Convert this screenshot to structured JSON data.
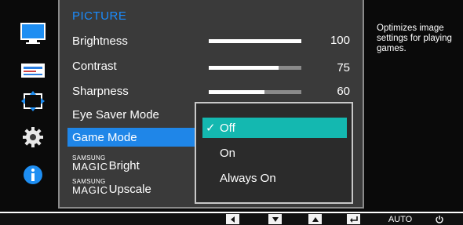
{
  "menu": {
    "title": "PICTURE",
    "items": [
      {
        "label": "Brightness",
        "value": "100",
        "level": 1.0
      },
      {
        "label": "Contrast",
        "value": "75",
        "level": 0.75
      },
      {
        "label": "Sharpness",
        "value": "60",
        "level": 0.6
      },
      {
        "label": "Eye Saver Mode"
      },
      {
        "label": "Game Mode"
      },
      {
        "prefix_top": "SAMSUNG",
        "prefix_bottom": "MAGIC",
        "label": "Bright"
      },
      {
        "prefix_top": "SAMSUNG",
        "prefix_bottom": "MAGIC",
        "label": "Upscale"
      }
    ]
  },
  "submenu": {
    "options": [
      "Off",
      "On",
      "Always On"
    ],
    "selected": "Off",
    "check_glyph": "✓"
  },
  "help": {
    "text": "Optimizes image settings for playing games."
  },
  "keybar": {
    "auto_label": "AUTO"
  },
  "icons": {
    "sidebar": [
      "monitor-icon",
      "size-position-icon",
      "resize-icon",
      "settings-gear-icon",
      "info-icon"
    ],
    "keys": [
      "left-arrow-icon",
      "down-arrow-icon",
      "up-arrow-icon",
      "enter-icon",
      "power-icon"
    ]
  },
  "colors": {
    "title_blue": "#1a8cff",
    "selected_row": "#1f86e8",
    "selected_option": "#14b8b0",
    "panel_bg": "#3a3a3a"
  }
}
